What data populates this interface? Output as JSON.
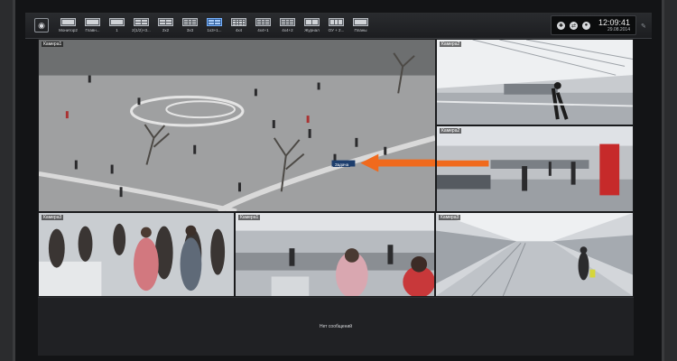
{
  "toolbar": {
    "logo_icon": "app-logo-icon",
    "layouts": [
      {
        "label": "Монитор2",
        "cells": 1,
        "active": false
      },
      {
        "label": "Главн...",
        "cells": 1,
        "active": false
      },
      {
        "label": "1",
        "cells": 1,
        "active": false
      },
      {
        "label": "2(1/2)+3...",
        "cells": 4,
        "active": false
      },
      {
        "label": "2x2",
        "cells": 4,
        "active": false
      },
      {
        "label": "3x3",
        "cells": 9,
        "active": false
      },
      {
        "label": "1x3+1...",
        "cells": 4,
        "active": true
      },
      {
        "label": "4x4",
        "cells": 16,
        "active": false
      },
      {
        "label": "4x4+1",
        "cells": 9,
        "active": false
      },
      {
        "label": "4x4+2",
        "cells": 9,
        "active": false
      },
      {
        "label": "Журнал",
        "cells": 2,
        "active": false
      },
      {
        "label": "ОУ + 2...",
        "cells": 3,
        "active": false
      },
      {
        "label": "Планы",
        "cells": 1,
        "active": false
      }
    ]
  },
  "status": {
    "icons": [
      "alarm-icon",
      "network-icon",
      "user-icon"
    ],
    "time": "12:09:41",
    "date": "29.08.2014"
  },
  "cameras": {
    "main": {
      "label": "Камера1"
    },
    "top_right": {
      "label": "Камера2"
    },
    "mid_right": {
      "label": "Камера2"
    },
    "bottom_left": {
      "label": "Камера3"
    },
    "bottom_mid": {
      "label": "Камера1"
    },
    "bottom_right": {
      "label": "Камера3"
    },
    "main_tag": "Задача"
  },
  "colors": {
    "accent": "#79b3ff",
    "arrow": "#f06a1d"
  },
  "messages": {
    "text": "Нет сообщений"
  }
}
